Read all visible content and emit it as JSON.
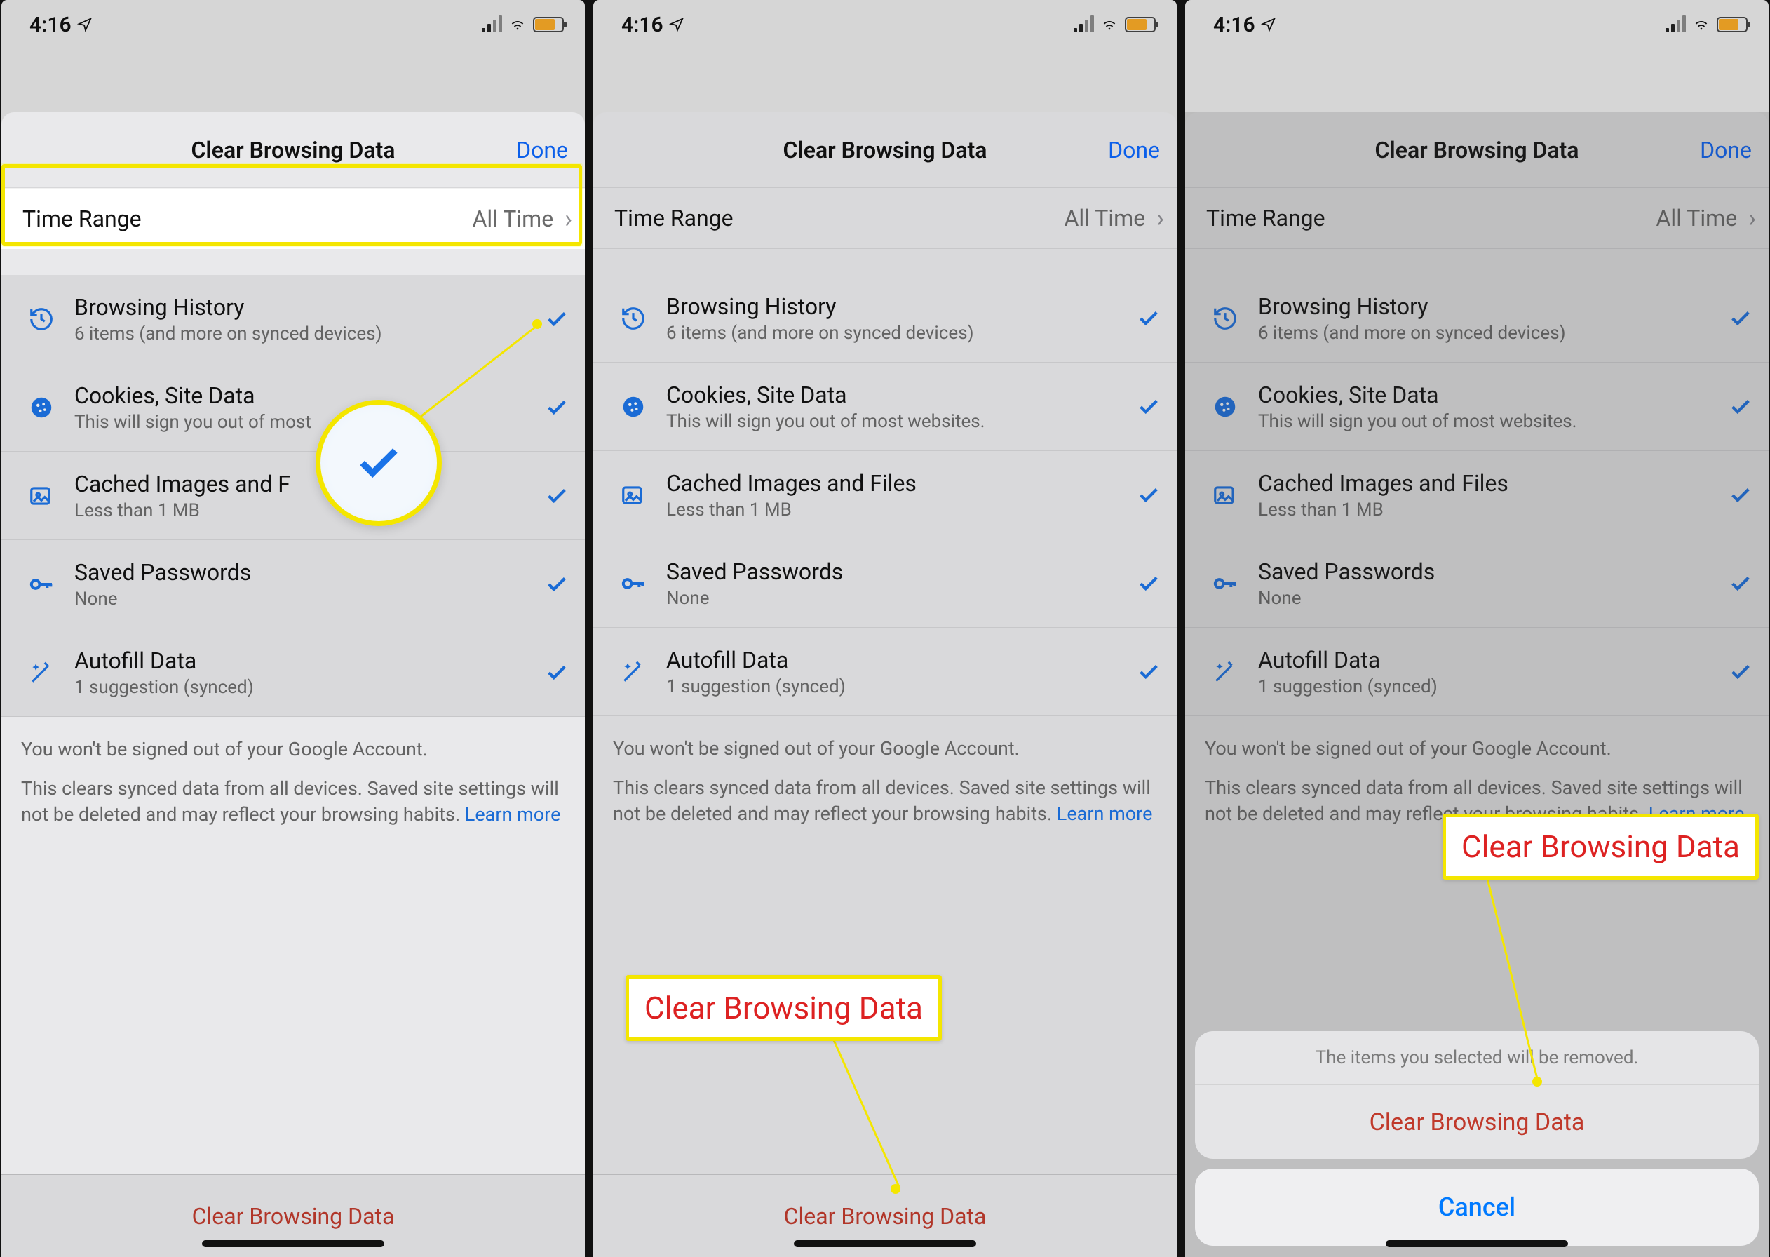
{
  "status": {
    "time": "4:16"
  },
  "header": {
    "title": "Clear Browsing Data",
    "done": "Done"
  },
  "time_range": {
    "label": "Time Range",
    "value": "All Time"
  },
  "items": [
    {
      "icon": "history-icon",
      "title": "Browsing History",
      "subtitle": "6 items (and more on synced devices)",
      "checked": true
    },
    {
      "icon": "cookie-icon",
      "title": "Cookies, Site Data",
      "subtitle": "This will sign you out of most websites.",
      "checked": true
    },
    {
      "icon": "image-icon",
      "title": "Cached Images and Files",
      "subtitle": "Less than 1 MB",
      "checked": true
    },
    {
      "icon": "key-icon",
      "title": "Saved Passwords",
      "subtitle": "None",
      "checked": true
    },
    {
      "icon": "wand-icon",
      "title": "Autofill Data",
      "subtitle": "1 suggestion (synced)",
      "checked": true
    }
  ],
  "footer": {
    "line1": "You won't be signed out of your Google Account.",
    "line2": "This clears synced data from all devices. Saved site settings will not be deleted and may reflect your browsing habits. ",
    "learn_more": "Learn more"
  },
  "clear_button": "Clear Browsing Data",
  "confirm": {
    "message": "The items you selected will be removed.",
    "confirm_label": "Clear Browsing Data",
    "cancel_label": "Cancel"
  },
  "callout": "Clear Browsing Data",
  "items_p1": {
    "cookies_subtitle_truncated": "This will sign you out of most",
    "cached_title_truncated": "Cached Images and F"
  },
  "footer_p3": {
    "line2_truncated": "This clears synced data from all devices. Saved site settings will not be deleted and may reflect your browsing habits. "
  }
}
